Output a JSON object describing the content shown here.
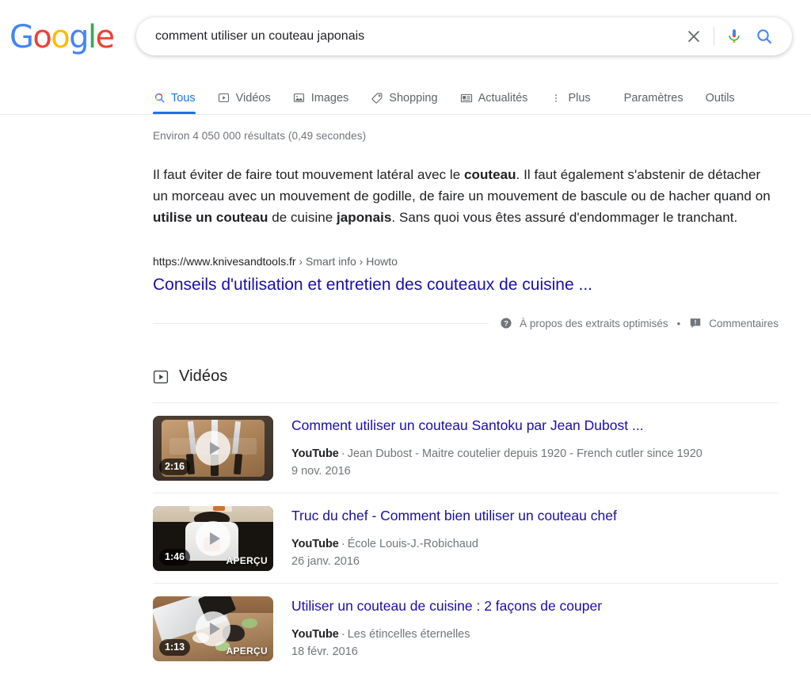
{
  "brand": {
    "name": "Google",
    "letters": [
      {
        "ch": "G",
        "color": "#4285F4"
      },
      {
        "ch": "o",
        "color": "#EA4335"
      },
      {
        "ch": "o",
        "color": "#FBBC05"
      },
      {
        "ch": "g",
        "color": "#4285F4"
      },
      {
        "ch": "l",
        "color": "#34A853"
      },
      {
        "ch": "e",
        "color": "#EA4335"
      }
    ]
  },
  "search": {
    "query": "comment utiliser un couteau japonais",
    "placeholder": "Rechercher",
    "clear_icon": "close-icon",
    "voice_icon": "microphone-icon",
    "submit_icon": "search-icon"
  },
  "nav": {
    "tabs": [
      {
        "label": "Tous",
        "icon": "search-icon",
        "active": true
      },
      {
        "label": "Vidéos",
        "icon": "video-icon",
        "active": false
      },
      {
        "label": "Images",
        "icon": "image-icon",
        "active": false
      },
      {
        "label": "Shopping",
        "icon": "tag-icon",
        "active": false
      },
      {
        "label": "Actualités",
        "icon": "news-icon",
        "active": false
      },
      {
        "label": "Plus",
        "icon": "more-vert-icon",
        "active": false
      }
    ],
    "right": [
      {
        "label": "Paramètres"
      },
      {
        "label": "Outils"
      }
    ]
  },
  "results": {
    "stats": "Environ 4 050 000 résultats (0,49 secondes)",
    "featured_snippet": {
      "parts": [
        {
          "t": "Il faut éviter de faire tout mouvement latéral avec le ",
          "b": false
        },
        {
          "t": "couteau",
          "b": true
        },
        {
          "t": ". Il faut également s'abstenir de détacher un morceau avec un mouvement de godille, de faire un mouvement de bascule ou de hacher quand on ",
          "b": false
        },
        {
          "t": "utilise un couteau",
          "b": true
        },
        {
          "t": " de cuisine ",
          "b": false
        },
        {
          "t": "japonais",
          "b": true
        },
        {
          "t": ". Sans quoi vous êtes assuré d'endommager le tranchant.",
          "b": false
        }
      ],
      "url_domain": "https://www.knivesandtools.fr",
      "url_crumbs": " › Smart info › Howto",
      "title": "Conseils d'utilisation et entretien des couteaux de cuisine ..."
    },
    "feedback": {
      "about_label": "À propos des extraits optimisés",
      "about_icon": "help-circle-icon",
      "separator": "•",
      "comments_label": "Commentaires",
      "comments_icon": "feedback-icon"
    }
  },
  "videos_section": {
    "heading": "Vidéos",
    "heading_icon": "video-icon",
    "items": [
      {
        "title": "Comment utiliser un couteau Santoku par Jean Dubost ...",
        "source": "YouTube",
        "separator": "·",
        "channel": "Jean Dubost - Maitre coutelier depuis 1920 - French cutler since 1920",
        "date": "9 nov. 2016",
        "duration": "2:16",
        "preview_label": "",
        "thumb_style": "knives-on-cutting-board"
      },
      {
        "title": "Truc du chef - Comment bien utiliser un couteau chef",
        "source": "YouTube",
        "separator": "·",
        "channel": "École Louis-J.-Robichaud",
        "date": "26 janv. 2016",
        "duration": "1:46",
        "preview_label": "APERÇU",
        "thumb_style": "chef-at-table"
      },
      {
        "title": "Utiliser un couteau de cuisine : 2 façons de couper",
        "source": "YouTube",
        "separator": "·",
        "channel": "Les étincelles éternelles",
        "date": "18 févr. 2016",
        "duration": "1:13",
        "preview_label": "APERÇU",
        "thumb_style": "knife-cutting-board"
      }
    ]
  },
  "colors": {
    "link": "#1a0dab",
    "accent": "#1a73e8",
    "muted": "#70757a",
    "text": "#202124"
  }
}
